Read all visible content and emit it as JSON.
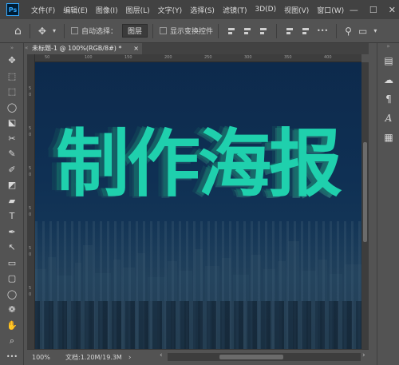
{
  "app": {
    "logo": "Ps"
  },
  "menu": [
    "文件(F)",
    "编辑(E)",
    "图像(I)",
    "图层(L)",
    "文字(Y)",
    "选择(S)",
    "滤镜(T)",
    "3D(D)",
    "视图(V)",
    "窗口(W)"
  ],
  "window_controls": {
    "minimize": "—",
    "maximize": "☐",
    "close": "✕"
  },
  "options": {
    "home_icon": "⌂",
    "move_icon": "✥",
    "auto_select_label": "自动选择：",
    "auto_select_value": "图层",
    "show_transform_label": "显示变换控件",
    "more_icon": "•••",
    "search_icon": "⚲",
    "frame_icon": "▭",
    "workspace_icon": "▾"
  },
  "tools": [
    "✥",
    "⬚",
    "⬚",
    "◯",
    "⬕",
    "✂",
    "✎",
    "✐",
    "◩",
    "▰",
    "T",
    "✒",
    "↖",
    "▭",
    "▢",
    "◯",
    "❁",
    "✋",
    "⌕",
    "•••"
  ],
  "document": {
    "tab_label": "未标题-1 @ 100%(RGB/8#) *",
    "tab_close": "×",
    "tab_grip": "«"
  },
  "ruler_top": [
    "50",
    "100",
    "150",
    "200",
    "250",
    "300",
    "350",
    "400"
  ],
  "ruler_left": [
    "5",
    "0",
    "5",
    "0",
    "5",
    "0",
    "5",
    "0",
    "5",
    "0",
    "5",
    "0"
  ],
  "poster": {
    "title": "制作海报",
    "title_color": "#1fd0ad",
    "background": "#0f3054"
  },
  "right_panel": [
    "▤",
    "☁",
    "¶",
    "A",
    "▦"
  ],
  "right_panel_grip": "»",
  "status": {
    "zoom": "100%",
    "doc_info": "文档:1.20M/19.3M",
    "arrow": "›",
    "scroll_left": "‹",
    "scroll_right": "›"
  }
}
